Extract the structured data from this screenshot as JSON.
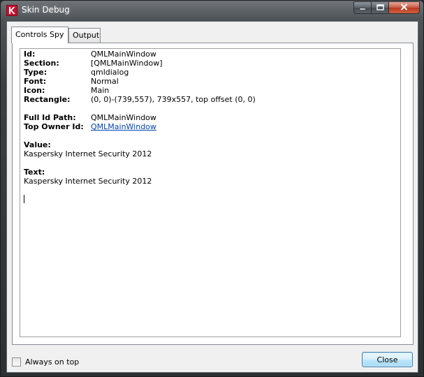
{
  "window": {
    "title": "Skin Debug"
  },
  "icons": {
    "app": "kaspersky-k-icon",
    "minimize": "minimize-icon",
    "maximize": "maximize-icon",
    "close": "close-icon"
  },
  "colors": {
    "link": "#0645ad",
    "close_caption": "#c8442c",
    "button_border": "#3c7fb1"
  },
  "tabs": [
    {
      "label": "Controls Spy",
      "active": true
    },
    {
      "label": "Output",
      "active": false
    }
  ],
  "properties": [
    {
      "key": "Id:",
      "value": "QMLMainWindow"
    },
    {
      "key": "Section:",
      "value": "[QMLMainWindow]"
    },
    {
      "key": "Type:",
      "value": "qmldialog"
    },
    {
      "key": "Font:",
      "value": "Normal"
    },
    {
      "key": "Icon:",
      "value": "Main"
    },
    {
      "key": "Rectangle:",
      "value": "(0, 0)-(739,557), 739x557, top offset (0, 0)"
    }
  ],
  "ownership": [
    {
      "key": "Full Id Path:",
      "value": "QMLMainWindow"
    },
    {
      "key": "Top Owner Id:",
      "value": "QMLMainWindow"
    }
  ],
  "value_section": {
    "label": "Value:",
    "text": "Kaspersky Internet Security 2012"
  },
  "text_section": {
    "label": "Text:",
    "text": "Kaspersky Internet Security 2012"
  },
  "always_on_top": {
    "label": "Always on top",
    "checked": false
  },
  "close_button": {
    "label": "Close"
  }
}
